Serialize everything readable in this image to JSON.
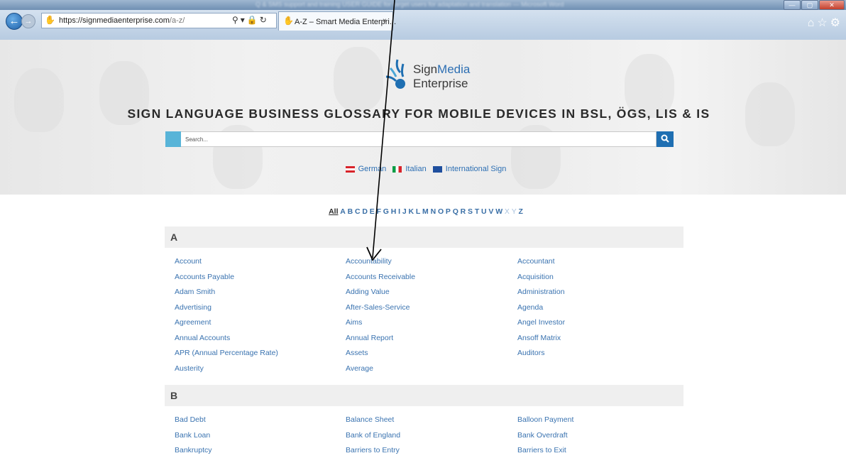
{
  "window": {
    "title": "Q & SMS support and training USER GUIDE for target users for adaptation and translation — Microsoft Word",
    "controls": [
      "—",
      "▢",
      "✕"
    ]
  },
  "browser": {
    "url_host": "https://signmediaenterprise.com",
    "url_path": "/a-z/",
    "tab_title": "A-Z – Smart Media Enterpri...",
    "tab_close": "×"
  },
  "hero": {
    "logo_sign": "Sign",
    "logo_media": "Media",
    "logo_enterprise": "Enterprise",
    "headline": "SIGN LANGUAGE BUSINESS GLOSSARY FOR MOBILE DEVICES IN BSL, ÖGS, LIS & IS",
    "search_placeholder": "Search...",
    "languages": [
      "German",
      "Italian",
      "International Sign"
    ]
  },
  "alphabet": {
    "all_label": "All",
    "letters": [
      "A",
      "B",
      "C",
      "D",
      "E",
      "F",
      "G",
      "H",
      "I",
      "J",
      "K",
      "L",
      "M",
      "N",
      "O",
      "P",
      "Q",
      "R",
      "S",
      "T",
      "U",
      "V",
      "W",
      "X",
      "Y",
      "Z"
    ],
    "disabled": [
      "X",
      "Y"
    ]
  },
  "sections": [
    {
      "letter": "A",
      "terms": [
        "Account",
        "Accountability",
        "Accountant",
        "Accounts Payable",
        "Accounts Receivable",
        "Acquisition",
        "Adam Smith",
        "Adding Value",
        "Administration",
        "Advertising",
        "After-Sales-Service",
        "Agenda",
        "Agreement",
        "Aims",
        "Angel Investor",
        "Annual Accounts",
        "Annual Report",
        "Ansoff Matrix",
        "APR (Annual Percentage Rate)",
        "Assets",
        "Auditors",
        "Austerity",
        "Average"
      ]
    },
    {
      "letter": "B",
      "terms": [
        "Bad Debt",
        "Balance Sheet",
        "Balloon Payment",
        "Bank Loan",
        "Bank of England",
        "Bank Overdraft",
        "Bankruptcy",
        "Barriers to Entry",
        "Barriers to Exit"
      ]
    }
  ]
}
